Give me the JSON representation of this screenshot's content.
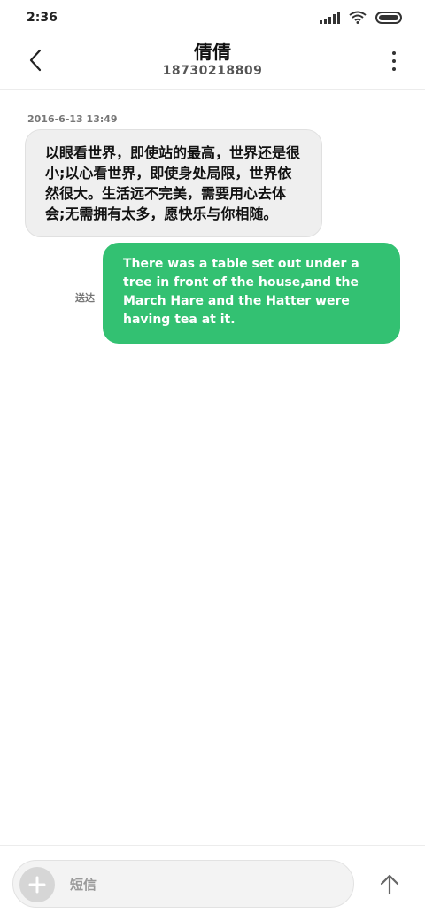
{
  "status_bar": {
    "time": "2:36",
    "icons": [
      "signal-icon",
      "wifi-icon",
      "battery-icon"
    ]
  },
  "header": {
    "back_icon": "chevron-left-icon",
    "contact_name": "倩倩",
    "contact_number": "18730218809",
    "more_icon": "more-vertical-icon"
  },
  "conversation": {
    "timestamp": "2016-6-13  13:49",
    "incoming_message": "以眼看世界，即使站的最高，世界还是很小;以心看世界，即使身处局限，世界依然很大。生活远不完美，需要用心去体会;无需拥有太多，愿快乐与你相随。",
    "outgoing_message": "There was a table set out under a tree in front of the house,and the March Hare and the Hatter were having tea at it.",
    "delivery_status": "送达"
  },
  "composer": {
    "add_icon": "plus-icon",
    "placeholder": "短信",
    "value": "",
    "send_icon": "arrow-up-icon"
  },
  "colors": {
    "outgoing_bubble": "#33c172",
    "incoming_bubble": "#efefef"
  }
}
